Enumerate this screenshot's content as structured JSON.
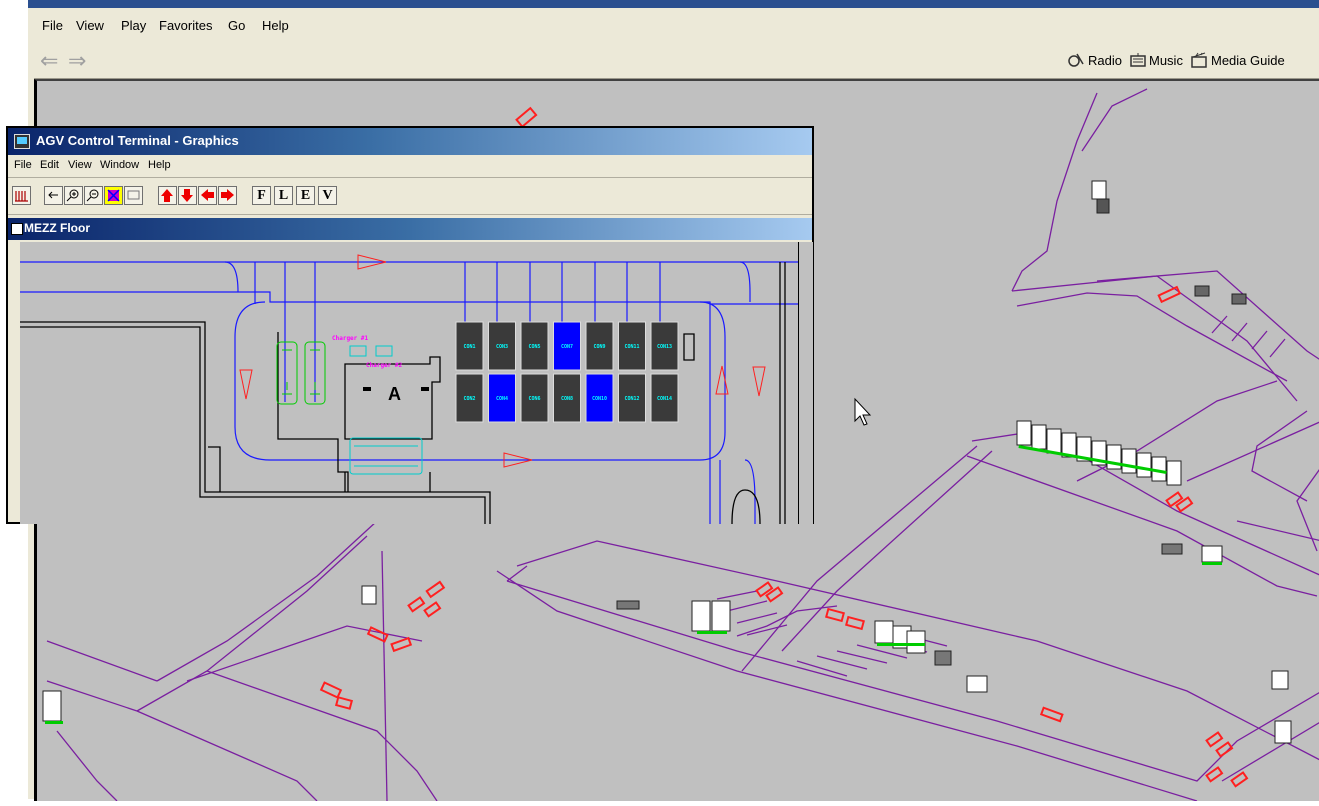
{
  "browser": {
    "menu": [
      "File",
      "View",
      "Play",
      "Favorites",
      "Go",
      "Help"
    ],
    "nav": {
      "back_icon": "back-arrow-icon",
      "forward_icon": "forward-arrow-icon"
    },
    "links": [
      {
        "label": "Radio",
        "icon": "radio-icon"
      },
      {
        "label": "Music",
        "icon": "music-icon"
      },
      {
        "label": "Media Guide",
        "icon": "media-guide-icon"
      }
    ]
  },
  "app": {
    "title": "AGV Control Terminal - Graphics",
    "menu": [
      "File",
      "Edit",
      "View",
      "Window",
      "Help"
    ],
    "toolbar_letters": [
      "F",
      "L",
      "E",
      "V"
    ],
    "child_title": "MEZZ Floor",
    "charger_labels": [
      "Charger #1",
      "Charger #2"
    ],
    "station_label": "A",
    "cells_top": [
      "CON1",
      "CON3",
      "CON5",
      "CON7",
      "CON9",
      "CON11",
      "CON13"
    ],
    "cells_bottom": [
      "CON2",
      "CON4",
      "CON6",
      "CON8",
      "CON10",
      "CON12",
      "CON14"
    ],
    "cells_top_active": [
      false,
      false,
      false,
      true,
      false,
      false,
      false
    ],
    "cells_bottom_active": [
      false,
      true,
      false,
      false,
      true,
      false,
      false
    ]
  },
  "colors": {
    "path": "#7a1fa0",
    "route": "#1a1aff",
    "agv_red": "#ff2020",
    "agv_green": "#00cc00",
    "cell_active": "#0000ff",
    "cell_idle": "#3a3a3a",
    "label": "#ff00ff",
    "cell_text": "#00ffff"
  }
}
